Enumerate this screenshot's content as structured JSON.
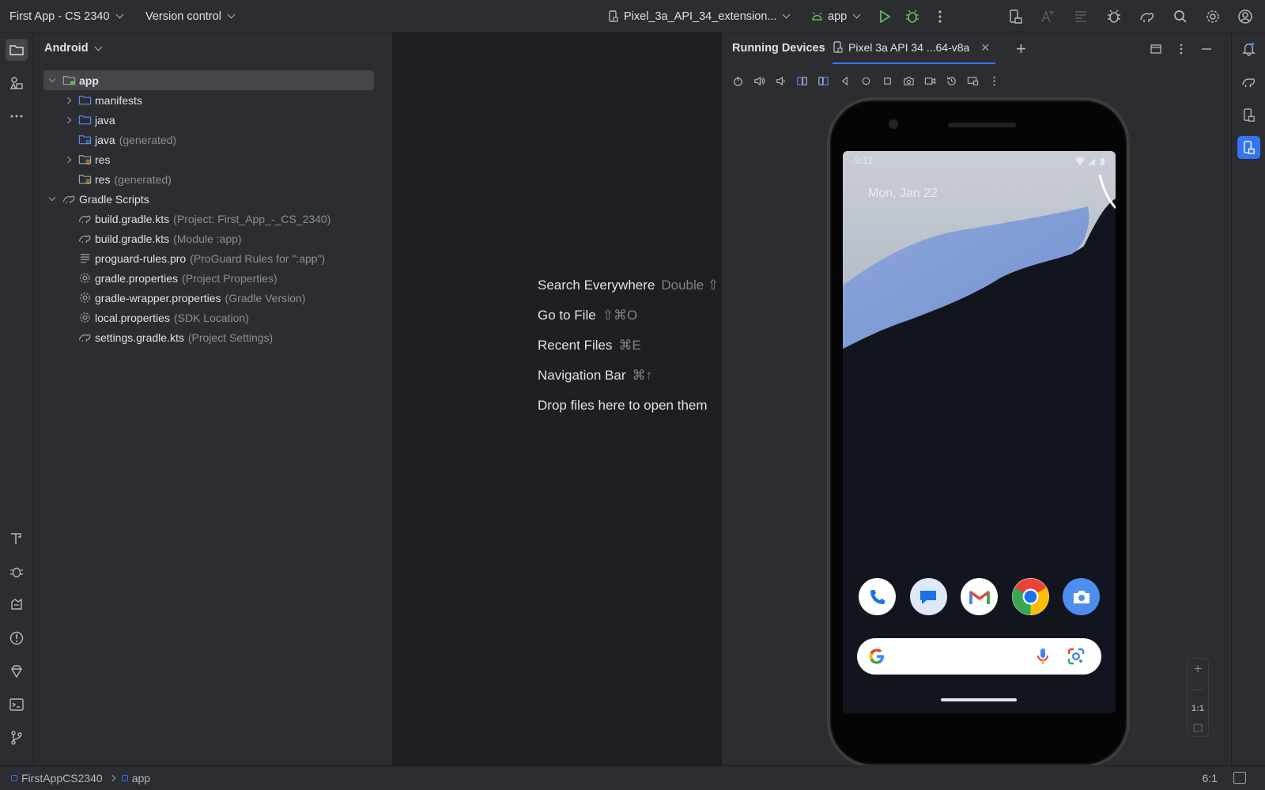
{
  "titlebar": {
    "project": "First App - CS 2340",
    "vcs": "Version control",
    "device": "Pixel_3a_API_34_extension...",
    "run_config": "app",
    "colors": {
      "run": "#5fb865",
      "debug": "#5fb865"
    }
  },
  "project_panel": {
    "view": "Android",
    "tree": [
      {
        "label": "app",
        "suffix": "",
        "depth": 0,
        "arrow": "open",
        "icon": "module-folder-icon",
        "selected": true
      },
      {
        "label": "manifests",
        "suffix": "",
        "depth": 1,
        "arrow": "closed",
        "icon": "folder-icon"
      },
      {
        "label": "java",
        "suffix": "",
        "depth": 1,
        "arrow": "closed",
        "icon": "folder-icon"
      },
      {
        "label": "java",
        "suffix": "(generated)",
        "depth": 1,
        "arrow": "none",
        "icon": "generated-folder-icon"
      },
      {
        "label": "res",
        "suffix": "",
        "depth": 1,
        "arrow": "closed",
        "icon": "res-folder-icon"
      },
      {
        "label": "res",
        "suffix": "(generated)",
        "depth": 1,
        "arrow": "none",
        "icon": "res-folder-icon"
      },
      {
        "label": "Gradle Scripts",
        "suffix": "",
        "depth": 0,
        "arrow": "open",
        "icon": "gradle-icon"
      },
      {
        "label": "build.gradle.kts",
        "suffix": "(Project: First_App_-_CS_2340)",
        "depth": 1,
        "arrow": "none",
        "icon": "gradle-icon"
      },
      {
        "label": "build.gradle.kts",
        "suffix": "(Module :app)",
        "depth": 1,
        "arrow": "none",
        "icon": "gradle-icon"
      },
      {
        "label": "proguard-rules.pro",
        "suffix": "(ProGuard Rules for \":app\")",
        "depth": 1,
        "arrow": "none",
        "icon": "text-file-icon"
      },
      {
        "label": "gradle.properties",
        "suffix": "(Project Properties)",
        "depth": 1,
        "arrow": "none",
        "icon": "gear-icon"
      },
      {
        "label": "gradle-wrapper.properties",
        "suffix": "(Gradle Version)",
        "depth": 1,
        "arrow": "none",
        "icon": "gear-icon"
      },
      {
        "label": "local.properties",
        "suffix": "(SDK Location)",
        "depth": 1,
        "arrow": "none",
        "icon": "gear-icon"
      },
      {
        "label": "settings.gradle.kts",
        "suffix": "(Project Settings)",
        "depth": 1,
        "arrow": "none",
        "icon": "gradle-icon"
      }
    ]
  },
  "editor": {
    "hints": [
      {
        "label": "Search Everywhere",
        "shortcut": "Double ⇧"
      },
      {
        "label": "Go to File",
        "shortcut": "⇧⌘O"
      },
      {
        "label": "Recent Files",
        "shortcut": "⌘E"
      },
      {
        "label": "Navigation Bar",
        "shortcut": "⌘↑"
      },
      {
        "label": "Drop files here to open them",
        "shortcut": ""
      }
    ]
  },
  "running_devices": {
    "title": "Running Devices",
    "tab": "Pixel 3a API 34 ...64-v8a",
    "phone": {
      "time": "9:12",
      "date": "Mon, Jan 22",
      "dock_apps": [
        "phone-app-icon",
        "messages-app-icon",
        "gmail-app-icon",
        "chrome-app-icon",
        "camera-app-icon"
      ]
    },
    "zoom_reset": "1:1"
  },
  "statusbar": {
    "crumbs": [
      "FirstAppCS2340",
      "app"
    ],
    "position": "6:1"
  }
}
